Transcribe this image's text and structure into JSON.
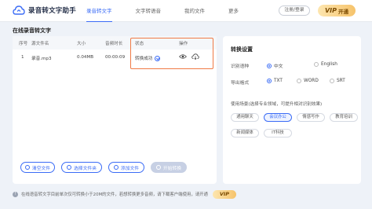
{
  "app": {
    "title": "录音转文字助手"
  },
  "nav": {
    "items": [
      {
        "label": "录音转文字",
        "active": true
      },
      {
        "label": "文字转语音",
        "active": false
      },
      {
        "label": "我的文件",
        "active": false
      },
      {
        "label": "更多",
        "active": false
      }
    ]
  },
  "header": {
    "login_label": "注册/登录",
    "vip_label": "开通",
    "vip_badge": "VIP"
  },
  "left_panel": {
    "title": "在线录音转文字",
    "columns": [
      "序号",
      "源文件名",
      "大小",
      "音频时长",
      "状态",
      "操作"
    ],
    "rows": [
      {
        "index": "1",
        "filename": "录音.mp3",
        "size": "0.04MB",
        "duration": "00:00:09",
        "status": "转换成功"
      }
    ],
    "buttons": {
      "clear": "清空文件",
      "add_folder": "选择文件夹",
      "add_file": "添加文件",
      "start": "开始转换"
    }
  },
  "settings": {
    "title": "转换设置",
    "language_label": "识别语种",
    "language_options": [
      "中文",
      "English"
    ],
    "language_selected": "中文",
    "export_label": "导出格式",
    "export_options": [
      "TXT",
      "WORD",
      "SRT"
    ],
    "export_selected": "TXT",
    "scene_tip": "使用场景(选择专业领域，可提升相对识别效果)",
    "scenes": [
      "通用聊天",
      "会议办公",
      "情感写作",
      "教育培训",
      "新闻媒体",
      "IT科技"
    ],
    "scene_selected": "会议办公"
  },
  "bottom": {
    "tip": "在线语音转文字目前单次仅可转换小于20M的文件，若想转换更多音频，请下载客户端使用，请开通",
    "vip_label": "VIP"
  },
  "colors": {
    "accent": "#3b6cf6",
    "highlight": "#f07a45",
    "vip": "#f6c36b"
  }
}
